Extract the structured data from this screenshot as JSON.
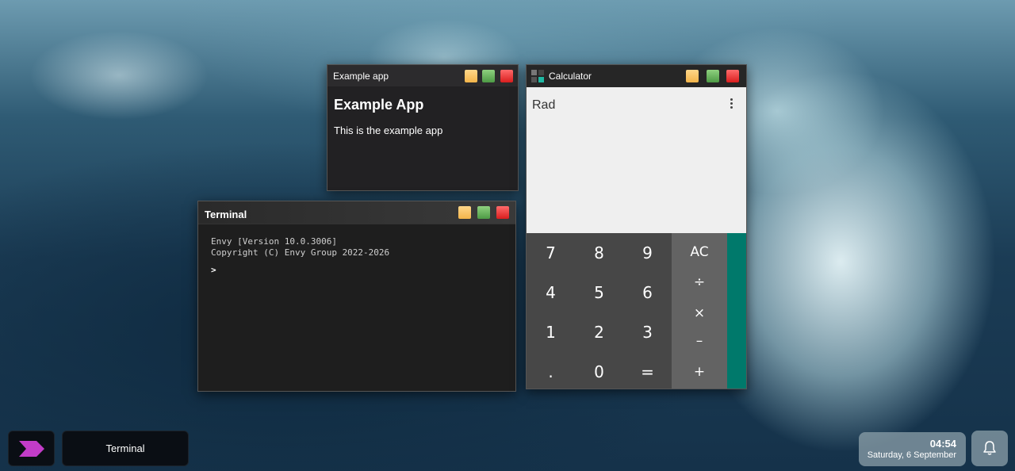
{
  "example_window": {
    "title": "Example app",
    "heading": "Example App",
    "text": "This is the example app"
  },
  "terminal_window": {
    "title": "Terminal",
    "version_line": "Envy [Version 10.0.3006]",
    "copyright_line": "Copyright (C) Envy Group 2022-2026",
    "prompt": ">"
  },
  "calculator_window": {
    "title": "Calculator",
    "mode": "Rad",
    "number_keys": [
      "7",
      "8",
      "9",
      "4",
      "5",
      "6",
      "1",
      "2",
      "3",
      ".",
      "0",
      "="
    ],
    "operator_keys": [
      "AC",
      "÷",
      "×",
      "–",
      "+"
    ],
    "accent_color": "#00796b"
  },
  "taskbar": {
    "start_icon": "envy-logo-icon",
    "start_color": "#c23cc8",
    "running_app": "Terminal",
    "time": "04:54",
    "date": "Saturday, 6 September",
    "notification_icon": "bell-icon"
  }
}
